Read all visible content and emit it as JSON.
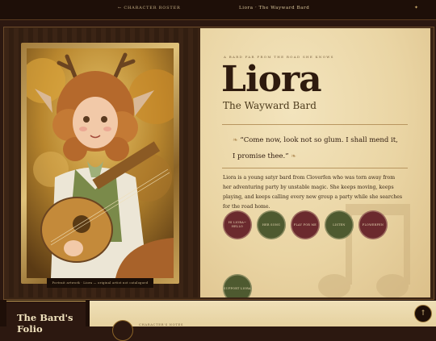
{
  "topbar": {
    "back_label": "← Character Roster",
    "page_title": "Liora · The Wayward Bard",
    "ornament": "✦"
  },
  "portrait": {
    "caption": "Portrait artwork · Liora — original artist not catalogued"
  },
  "profile": {
    "overline": "A bard far from the road she knows",
    "name": "Liora",
    "subtitle": "The Wayward Bard",
    "quote": "“Come now, look not so glum. I shall mend it, I promise thee.”",
    "quote_flourish": "❧",
    "bio": "Liora is a young satyr bard from Cloverfen who was torn away from her adventuring party by unstable magic. She keeps moving, keeps playing, and keeps calling every new group a party while she searches for the road home."
  },
  "actions": [
    {
      "label": "Hi Liora~ Hello",
      "color": "red"
    },
    {
      "label": "Her Song",
      "color": "green"
    },
    {
      "label": "Play for me",
      "color": "red"
    },
    {
      "label": "Listen",
      "color": "green"
    },
    {
      "label": "Flowerfen",
      "color": "red"
    },
    {
      "label": "Support Liora",
      "color": "green"
    }
  ],
  "folio": {
    "title": "The Bard's Folio",
    "label": "Character's Notes"
  },
  "scroll_top": "↑",
  "colors": {
    "wood_dark": "#2c1810",
    "parchment": "#ead5a4",
    "accent_gold": "#c9a45a",
    "button_red": "#6b2a2e",
    "button_green": "#4e5a30"
  }
}
